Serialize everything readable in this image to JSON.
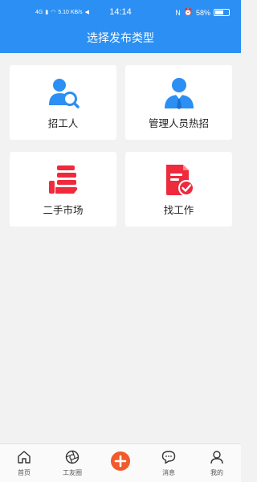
{
  "status_bar": {
    "network": "4G",
    "speed": "5.10 KB/s",
    "time": "14:14",
    "battery": "58%"
  },
  "header": {
    "title": "选择发布类型"
  },
  "cards": [
    {
      "label": "招工人",
      "icon": "recruit-worker-icon"
    },
    {
      "label": "管理人员热招",
      "icon": "manager-icon"
    },
    {
      "label": "二手市场",
      "icon": "second-hand-market-icon"
    },
    {
      "label": "找工作",
      "icon": "find-job-icon"
    }
  ],
  "tabbar": {
    "items": [
      {
        "label": "首页",
        "icon": "home-icon"
      },
      {
        "label": "工友圈",
        "icon": "camera-shutter-icon"
      },
      {
        "label": "",
        "icon": "plus-icon"
      },
      {
        "label": "消息",
        "icon": "chat-bubble-icon"
      },
      {
        "label": "我的",
        "icon": "user-icon"
      }
    ]
  },
  "colors": {
    "primary": "#2b8ff3",
    "accent_red": "#ee2a3c",
    "plus_button": "#f15a2b"
  }
}
